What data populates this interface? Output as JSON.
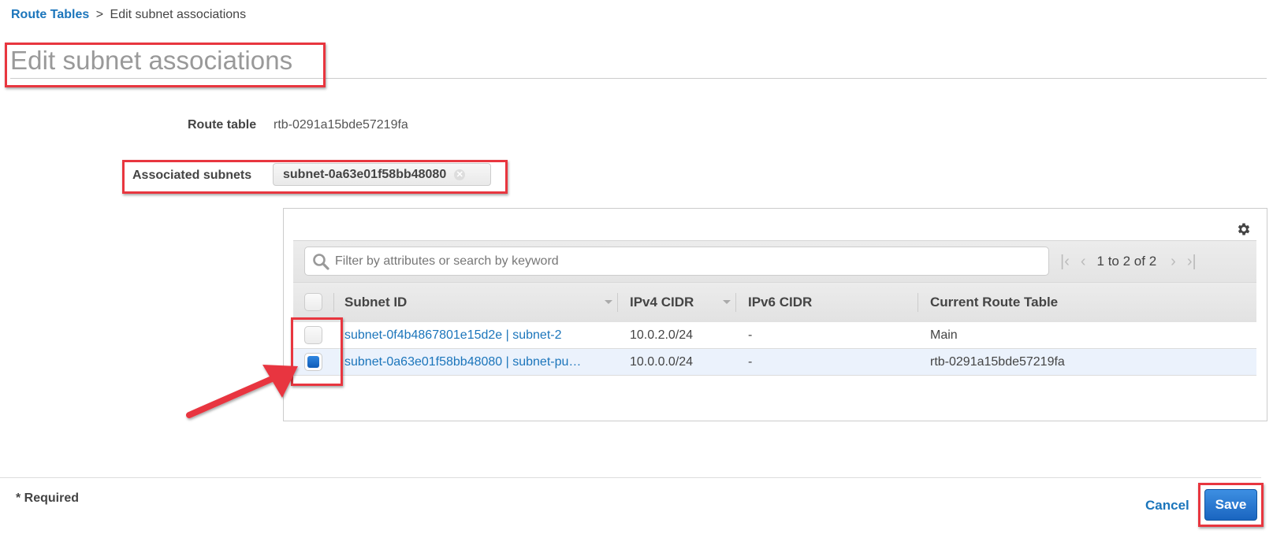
{
  "breadcrumb": {
    "parent": "Route Tables",
    "separator": ">",
    "current": "Edit subnet associations"
  },
  "page": {
    "title": "Edit subnet associations"
  },
  "form": {
    "route_table_label": "Route table",
    "route_table_value": "rtb-0291a15bde57219fa",
    "associated_subnets_label": "Associated subnets",
    "associated_subnets": [
      "subnet-0a63e01f58bb48080"
    ]
  },
  "table": {
    "search_placeholder": "Filter by attributes or search by keyword",
    "search_value": "",
    "pagination": "1 to 2 of 2",
    "columns": [
      "Subnet ID",
      "IPv4 CIDR",
      "IPv6 CIDR",
      "Current Route Table"
    ],
    "rows": [
      {
        "checked": false,
        "subnet": "subnet-0f4b4867801e15d2e | subnet-2",
        "ipv4": "10.0.2.0/24",
        "ipv6": "-",
        "route_table": "Main"
      },
      {
        "checked": true,
        "subnet": "subnet-0a63e01f58bb48080 | subnet-pu…",
        "ipv4": "10.0.0.0/24",
        "ipv6": "-",
        "route_table": "rtb-0291a15bde57219fa"
      }
    ]
  },
  "footer": {
    "required_note": "* Required",
    "cancel_label": "Cancel",
    "save_label": "Save"
  },
  "colors": {
    "link": "#1b75bb",
    "primary_button": "#1a65c0",
    "annotation": "#e8363f",
    "selected_row": "#ebf2fc"
  },
  "icons": {
    "settings": "gear-icon",
    "search": "search-icon",
    "first_page": "first-page-icon",
    "prev_page": "prev-page-icon",
    "next_page": "next-page-icon",
    "last_page": "last-page-icon",
    "remove_token": "remove-token-icon"
  }
}
